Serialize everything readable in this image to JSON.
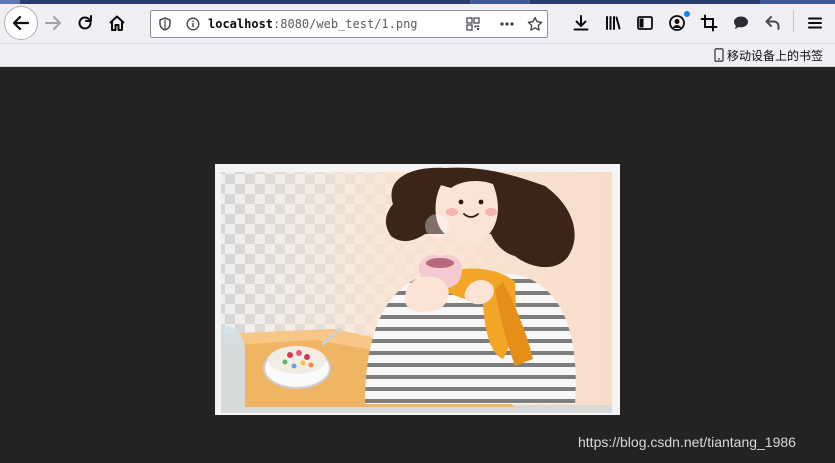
{
  "browser": {
    "url": {
      "host": "localhost",
      "rest": ":8080/web_test/1.png"
    },
    "bookmarks": {
      "mobile_label": "移动设备上的书签"
    }
  },
  "icons": {
    "back": "arrow-left-icon",
    "forward": "arrow-right-icon",
    "reload": "reload-icon",
    "home": "home-icon",
    "tracking": "shield-icon",
    "info": "info-icon",
    "qr": "qr-code-icon",
    "more": "more-actions-icon",
    "star": "bookmark-star-icon",
    "download": "download-icon",
    "library": "library-icon",
    "sidebar": "sidebar-icon",
    "account": "account-icon",
    "screenshot": "crop-icon",
    "chat": "speech-bubble-icon",
    "undo": "undo-icon",
    "menu": "hamburger-menu-icon",
    "mobile": "mobile-phone-icon"
  },
  "colors": {
    "page_background": "#232323",
    "toolbar": "#f0f0f4",
    "accent": "#0a84ff"
  },
  "watermark": "https://blog.csdn.net/tiantang_1986"
}
